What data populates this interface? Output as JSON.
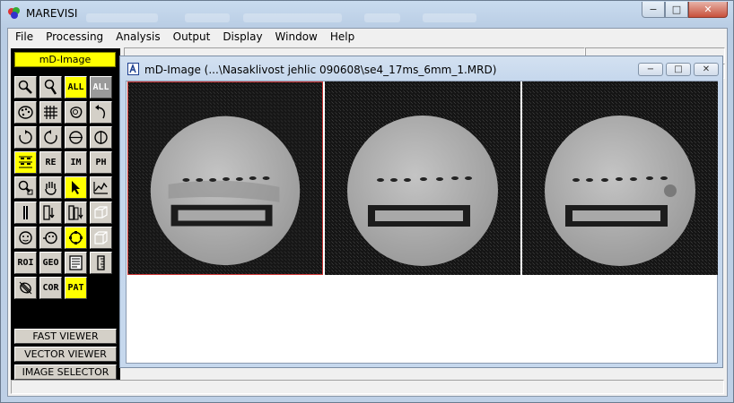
{
  "app": {
    "title": "MAREVISI"
  },
  "window_controls": {
    "minimize": "−",
    "maximize": "□",
    "close": "✕"
  },
  "menu": [
    {
      "label": "File"
    },
    {
      "label": "Processing"
    },
    {
      "label": "Analysis"
    },
    {
      "label": "Output"
    },
    {
      "label": "Display"
    },
    {
      "label": "Window"
    },
    {
      "label": "Help"
    }
  ],
  "toolbox": {
    "title": "mD-Image",
    "text_buttons": {
      "all": "ALL",
      "all_multi": "ALL",
      "re": "RE",
      "im": "IM",
      "ph": "PH",
      "roi": "ROI",
      "geo": "GEO",
      "cor": "COR",
      "pat": "PAT"
    },
    "wide_buttons": [
      "FAST VIEWER",
      "VECTOR VIEWER",
      "IMAGE SELECTOR"
    ]
  },
  "child_window": {
    "title": "mD-Image  (...\\Nasaklivost jehlic 090608\\se4_17ms_6mm_1.MRD)",
    "selected_image": 1
  },
  "colors": {
    "toolbox_bg": "#000000",
    "highlight": "#ffff00",
    "selection_border": "#cc3333"
  }
}
